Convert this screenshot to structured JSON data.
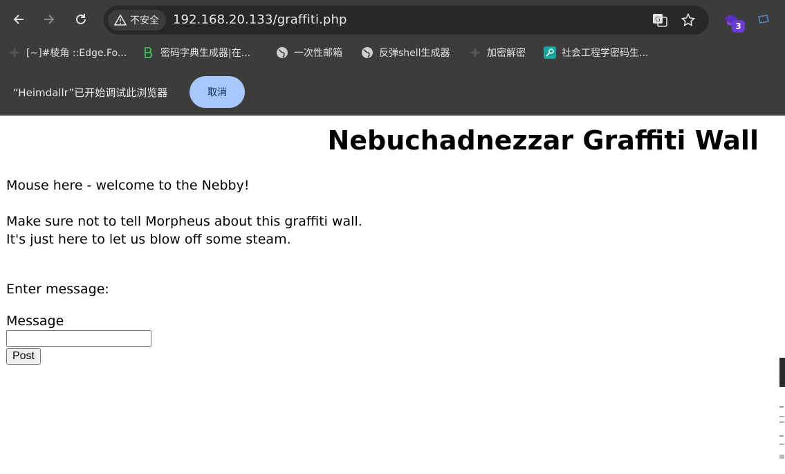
{
  "browser": {
    "security_label": "不安全",
    "url": "192.168.20.133/graffiti.php",
    "extension_badge": "3",
    "bookmarks": [
      {
        "label": "[~]#棱角 ::Edge.Fo...",
        "icon": "ninja-star-icon"
      },
      {
        "label": "密码字典生成器|在...",
        "icon": "dict-icon"
      },
      {
        "label": "一次性邮箱",
        "icon": "globe-icon"
      },
      {
        "label": "反弹shell生成器",
        "icon": "globe-icon"
      },
      {
        "label": "加密解密",
        "icon": "ninja-star-icon"
      },
      {
        "label": "社会工程学密码生...",
        "icon": "key-icon"
      }
    ],
    "infobar_message": "“Heimdallr”已开始调试此浏览器",
    "infobar_cancel": "取消"
  },
  "page": {
    "title": "Nebuchadnezzar Graffiti Wall",
    "welcome": "Mouse here - welcome to the Nebby!",
    "line1": "Make sure not to tell Morpheus about this graffiti wall.",
    "line2": "It's just here to let us blow off some steam.",
    "enter_message": "Enter message:",
    "message_label": "Message",
    "message_value": "",
    "post_label": "Post"
  },
  "colors": {
    "chrome_bg": "#3c3c3c",
    "omnibox_bg": "#282828",
    "cancel_bg": "#a8c7fa",
    "badge_bg": "#6d3bd8"
  }
}
